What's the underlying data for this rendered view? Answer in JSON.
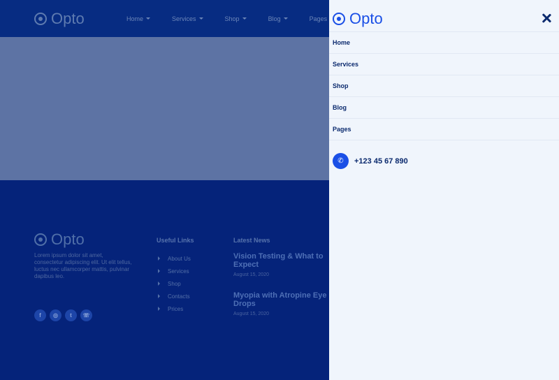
{
  "brand": {
    "name": "Opto"
  },
  "header": {
    "nav": [
      {
        "label": "Home",
        "caret": true
      },
      {
        "label": "Services",
        "caret": true
      },
      {
        "label": "Shop",
        "caret": true
      },
      {
        "label": "Blog",
        "caret": true
      },
      {
        "label": "Pages",
        "caret": false
      }
    ]
  },
  "footer": {
    "about": "Lorem ipsum dolor sit amet, consectetur adipiscing elit. Ut elit tellus, luctus nec ullamcorper mattis, pulvinar dapibus leo.",
    "socials": [
      {
        "icon": "facebook-icon",
        "glyph": "f"
      },
      {
        "icon": "instagram-icon",
        "glyph": "◎"
      },
      {
        "icon": "twitter-icon",
        "glyph": "t"
      },
      {
        "icon": "whatsapp-icon",
        "glyph": "☏"
      }
    ],
    "useful_links": {
      "title": "Useful Links",
      "items": [
        "About Us",
        "Services",
        "Shop",
        "Contacts",
        "Prices"
      ]
    },
    "latest_news": {
      "title": "Latest News",
      "items": [
        {
          "title": "Vision Testing & What to Expect",
          "date": "August 15, 2020"
        },
        {
          "title": "Myopia with Atropine Eye Drops",
          "date": "August 15, 2020"
        }
      ]
    }
  },
  "offcanvas": {
    "menu": [
      "Home",
      "Services",
      "Shop",
      "Blog",
      "Pages"
    ],
    "phone": "+123 45 67 890"
  },
  "colors": {
    "accent": "#1a4fe6",
    "navy": "#0b2a6e",
    "panel_bg": "#f0f5fc"
  }
}
